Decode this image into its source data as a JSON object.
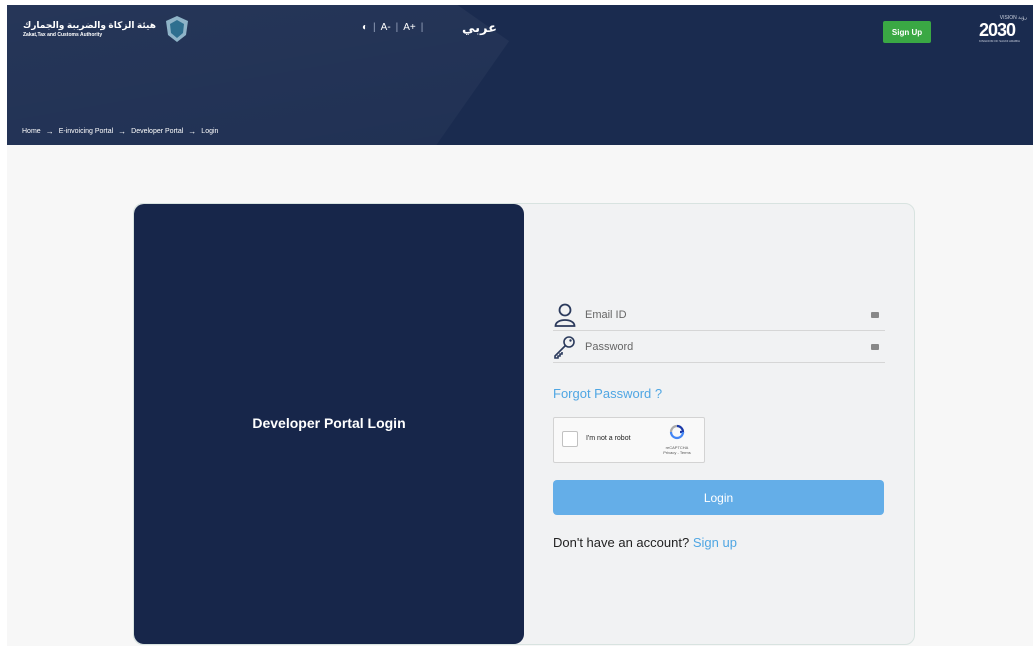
{
  "header": {
    "logo_ar": "هيئة الزكاة والضريبة والجمارك",
    "logo_en": "Zakat,Tax and Customs Authority",
    "a11y": {
      "contrast_icon": "◐",
      "decrease": "A-",
      "increase": "A+"
    },
    "lang": "عربي",
    "signup": "Sign Up",
    "vision": {
      "top": "VISION رؤية",
      "number": "2030",
      "sub": "KINGDOM OF SAUDI ARABIA"
    }
  },
  "breadcrumb": {
    "items": [
      "Home",
      "E-invoicing Portal",
      "Developer Portal",
      "Login"
    ],
    "separator": "→"
  },
  "panel": {
    "title": "Developer Portal Login"
  },
  "form": {
    "email_placeholder": "Email ID",
    "password_placeholder": "Password",
    "forgot": "Forgot Password ?",
    "captcha": {
      "label": "I'm not a robot",
      "brand": "reCAPTCHA",
      "terms": "Privacy - Terms"
    },
    "login": "Login",
    "no_account": "Don't have an account?",
    "signup_link": "Sign up"
  },
  "colors": {
    "header_bg": "#1a2b4f",
    "panel_bg": "#17264a",
    "accent": "#4fa6e3",
    "login_btn": "#64aee8",
    "signup_btn": "#3aa844"
  }
}
